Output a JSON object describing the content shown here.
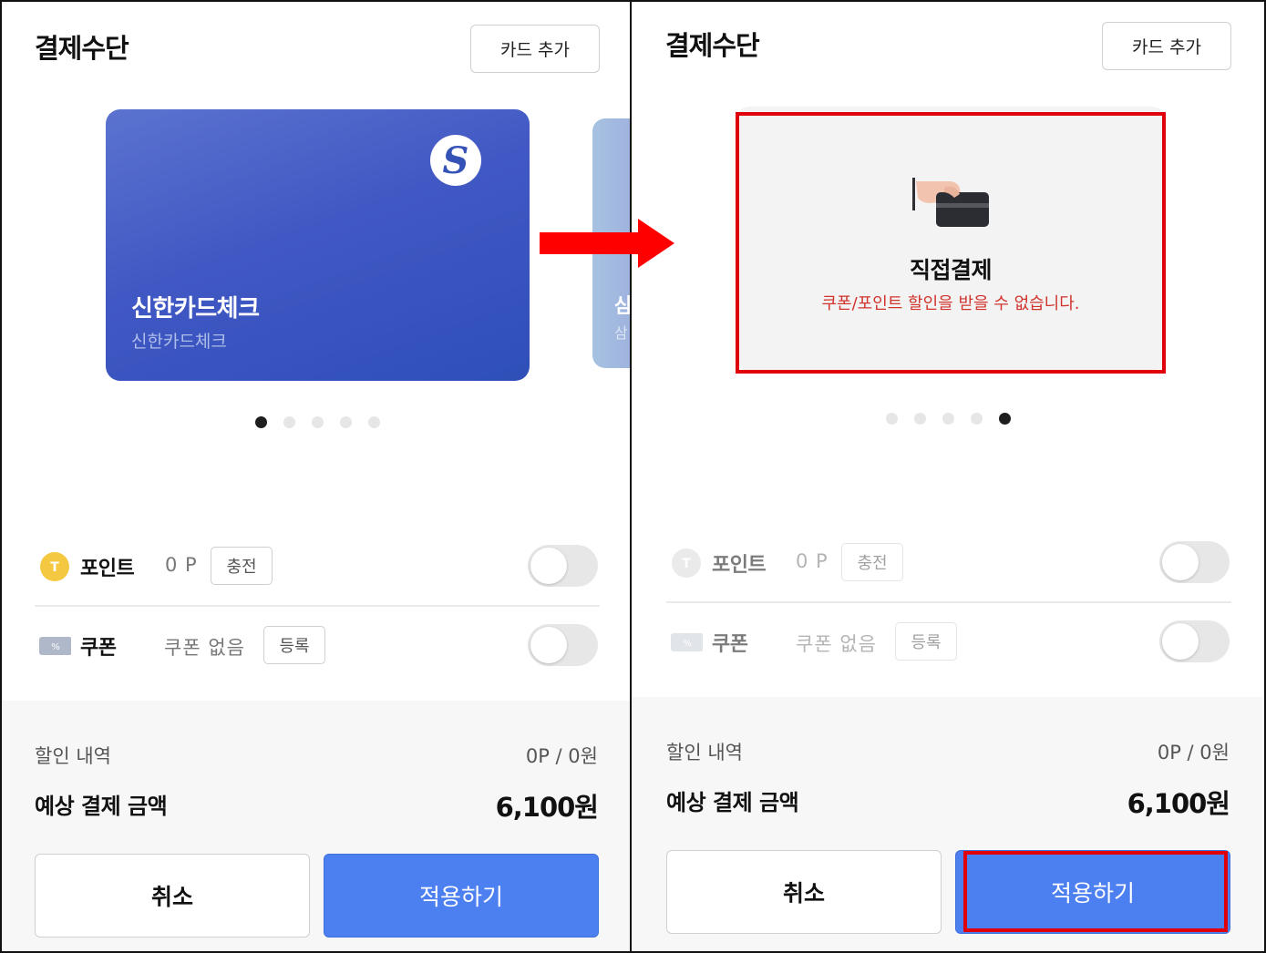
{
  "left": {
    "title": "결제수단",
    "add_card_label": "카드 추가",
    "card": {
      "name": "신한카드체크",
      "sub": "신한카드체크",
      "logo_glyph": "S",
      "logo_icon": "shinhan-logo-icon"
    },
    "next_card": {
      "name": "삼",
      "sub": "삼"
    },
    "pager": {
      "count": 5,
      "active": 1
    },
    "points": {
      "label": "포인트",
      "value": "0 P",
      "button": "충전",
      "icon": "point-coin-icon",
      "icon_glyph": "T",
      "enabled": false
    },
    "coupon": {
      "label": "쿠폰",
      "value": "쿠폰 없음",
      "button": "등록",
      "icon": "coupon-ticket-icon",
      "enabled": false
    },
    "summary": {
      "discount_label": "할인 내역",
      "discount_value": "0P / 0원",
      "total_label": "예상 결제 금액",
      "total_value": "6,100원"
    },
    "cancel_label": "취소",
    "apply_label": "적용하기"
  },
  "right": {
    "title": "결제수단",
    "add_card_label": "카드 추가",
    "direct": {
      "title": "직접결제",
      "warning": "쿠폰/포인트 할인을 받을 수 없습니다.",
      "icon": "hand-card-icon"
    },
    "pager": {
      "count": 5,
      "active": 5
    },
    "points": {
      "label": "포인트",
      "value": "0 P",
      "button": "충전",
      "icon": "point-coin-icon",
      "icon_glyph": "T",
      "enabled": false
    },
    "coupon": {
      "label": "쿠폰",
      "value": "쿠폰 없음",
      "button": "등록",
      "icon": "coupon-ticket-icon",
      "enabled": false
    },
    "summary": {
      "discount_label": "할인 내역",
      "discount_value": "0P / 0원",
      "total_label": "예상 결제 금액",
      "total_value": "6,100원"
    },
    "cancel_label": "취소",
    "apply_label": "적용하기"
  },
  "colors": {
    "accent": "#4c7ff0",
    "highlight": "#e0000b",
    "card": "#3f56c2",
    "warning": "#d0342c"
  }
}
